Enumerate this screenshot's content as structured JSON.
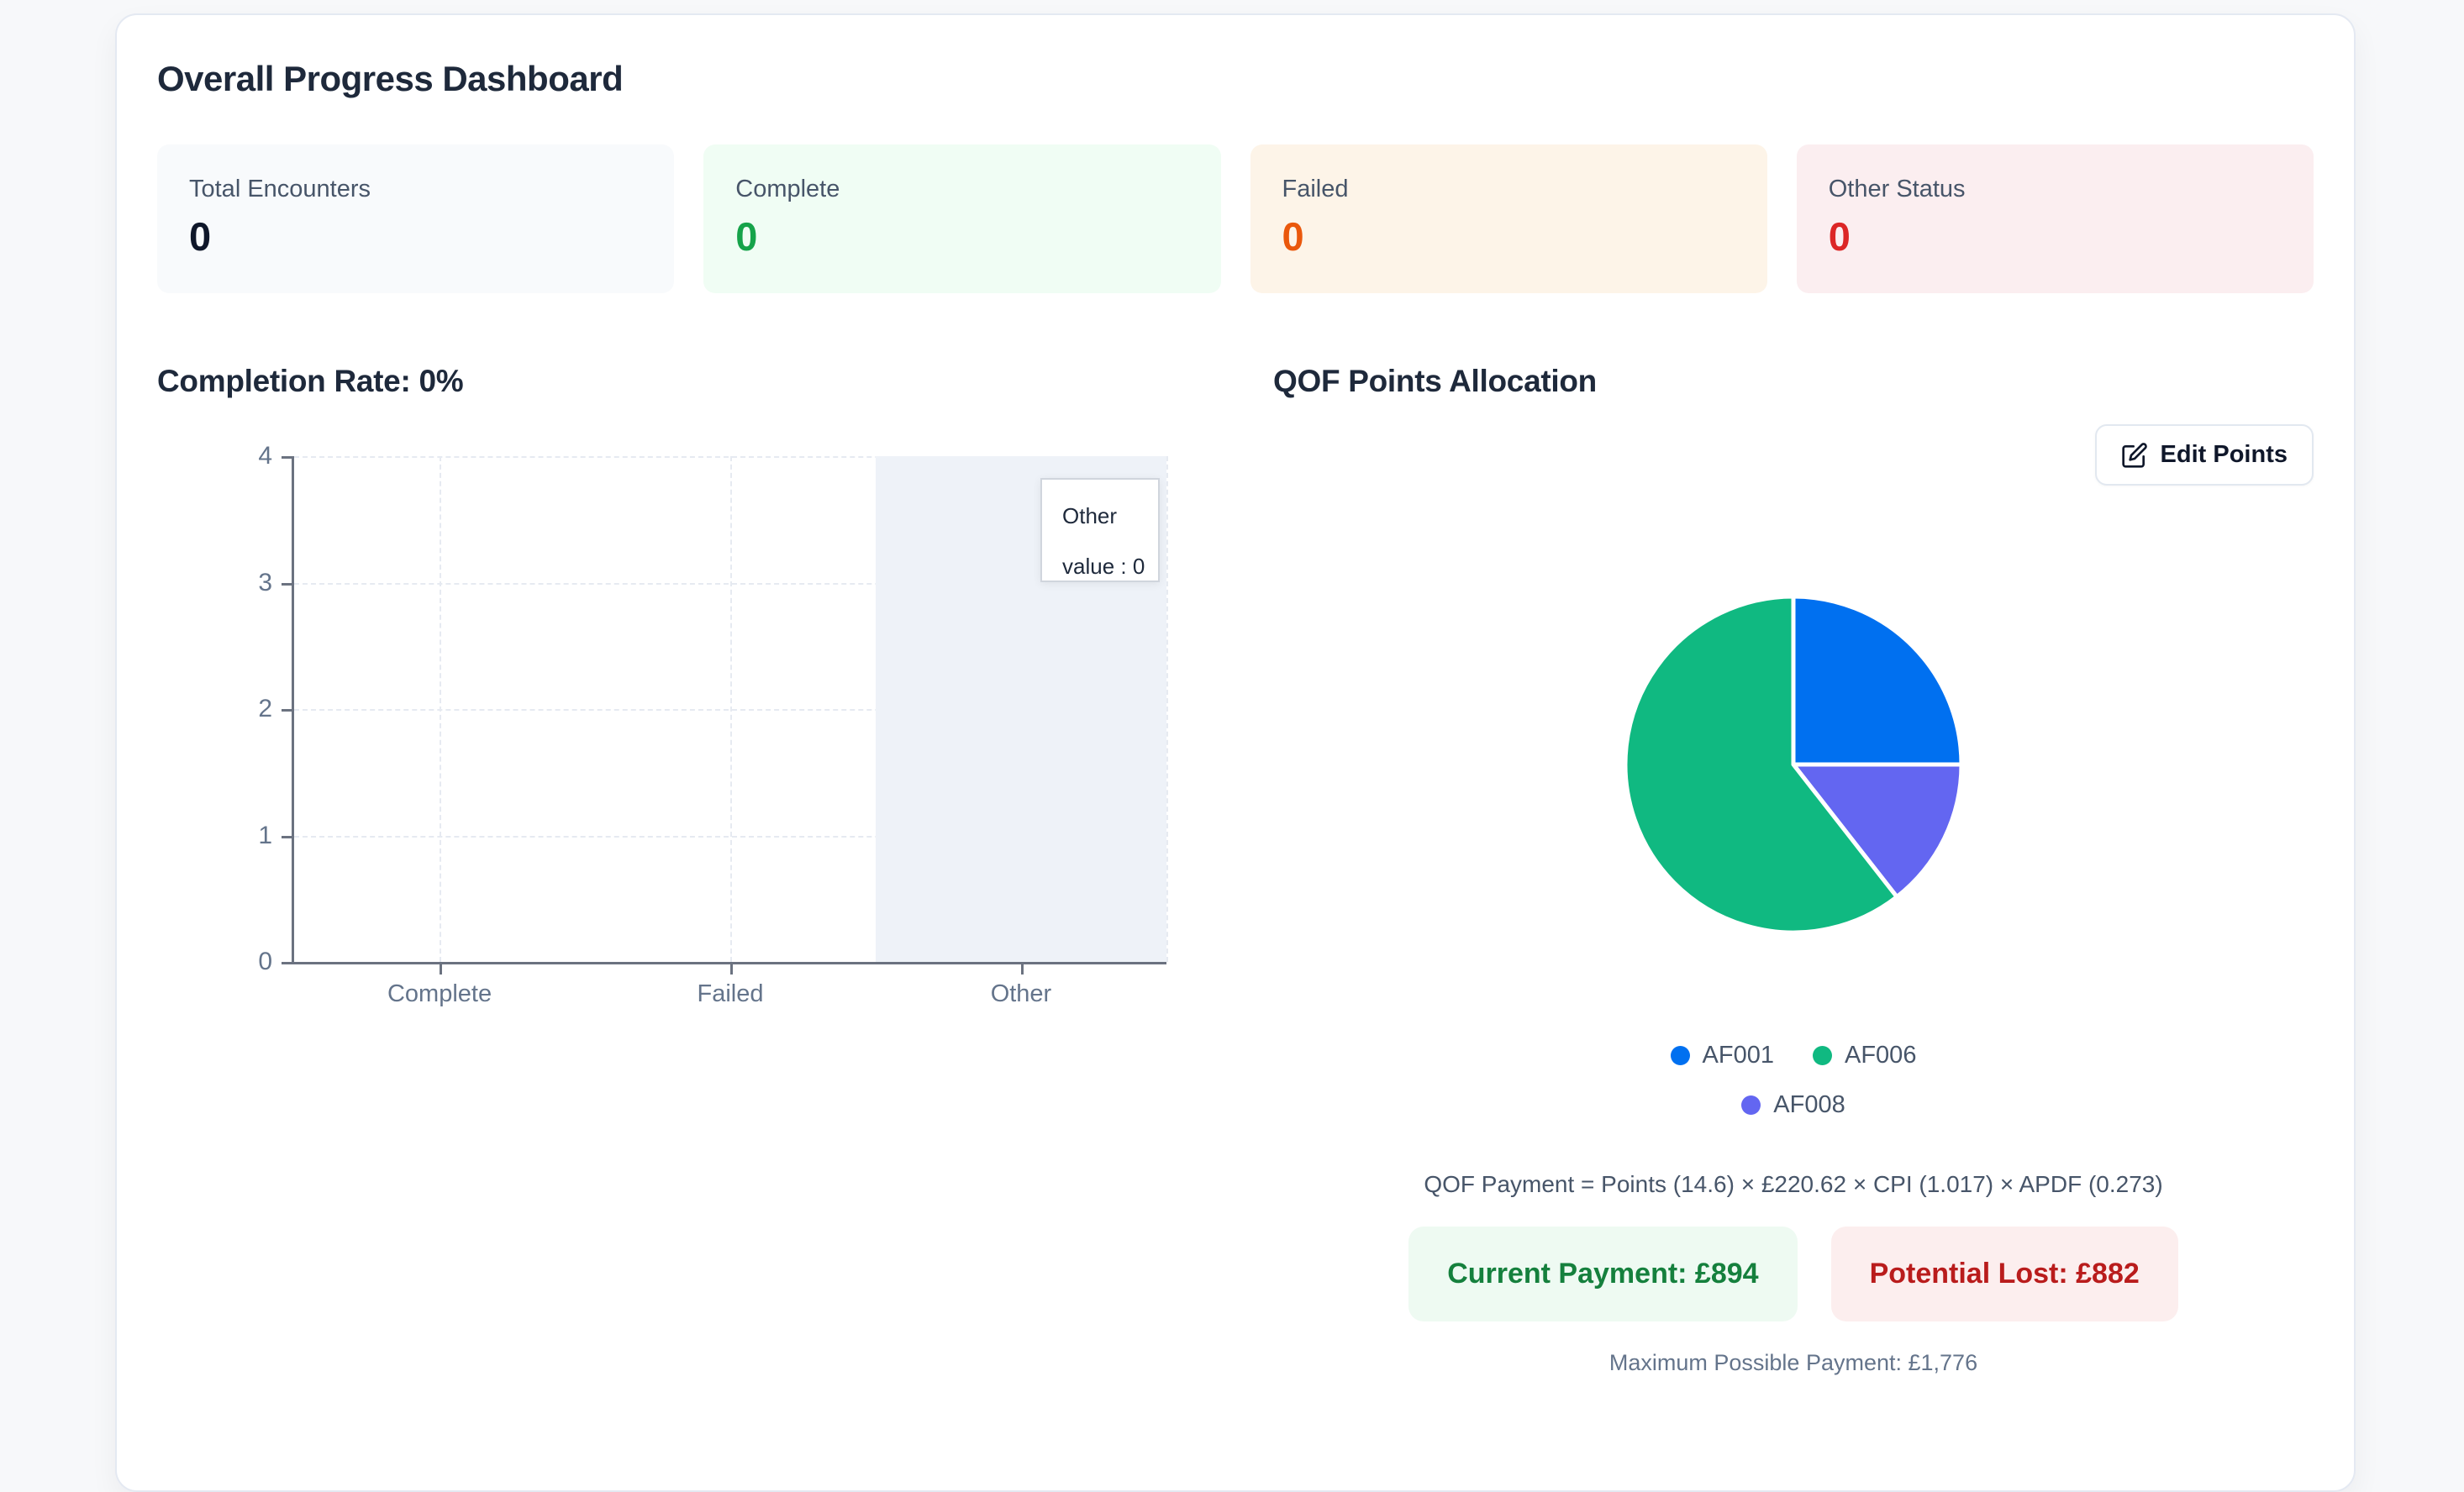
{
  "header": {
    "title": "Overall Progress Dashboard"
  },
  "stats": {
    "cards": [
      {
        "label": "Total Encounters",
        "value": "0",
        "bg": "#f8fafc",
        "value_color": "#0f172a"
      },
      {
        "label": "Complete",
        "value": "0",
        "bg": "#f0fdf4",
        "value_color": "#16a34a"
      },
      {
        "label": "Failed",
        "value": "0",
        "bg": "#fdf4e8",
        "value_color": "#ea580c"
      },
      {
        "label": "Other Status",
        "value": "0",
        "bg": "#fbeef0",
        "value_color": "#dc2626"
      }
    ]
  },
  "qof": {
    "edit_button_label": "Edit Points",
    "formula": "QOF Payment = Points (14.6) × £220.62 × CPI (1.017) × APDF (0.273)",
    "current_payment": "Current Payment: £894",
    "potential_lost": "Potential Lost: £882",
    "max_payment": "Maximum Possible Payment: £1,776",
    "current_payment_colors": {
      "bg": "#eefaf2",
      "text": "#15803d"
    },
    "potential_lost_colors": {
      "bg": "#fceeee",
      "text": "#b91c1c"
    }
  },
  "chart_data": [
    {
      "type": "bar",
      "title": "Completion Rate: 0%",
      "categories": [
        "Complete",
        "Failed",
        "Other"
      ],
      "values": [
        0,
        0,
        0
      ],
      "xlabel": "",
      "ylabel": "",
      "ylim": [
        0,
        4
      ],
      "yticks": [
        4,
        3,
        2,
        1,
        0
      ],
      "grid": "dashed horizontal and vertical",
      "legend_position": "none",
      "hover": {
        "category": "Other",
        "band_color": "#eef2f8"
      },
      "tooltip": {
        "title": "Other",
        "value_line": "value : 0"
      }
    },
    {
      "type": "pie",
      "title": "QOF Points Allocation",
      "legend_position": "bottom",
      "series": [
        {
          "name": "AF001",
          "percent": 25.0,
          "color": "#0070f0"
        },
        {
          "name": "AF006",
          "percent": 60.6,
          "color": "#10b981"
        },
        {
          "name": "AF008",
          "percent": 14.4,
          "color": "#6366f1"
        }
      ]
    }
  ]
}
